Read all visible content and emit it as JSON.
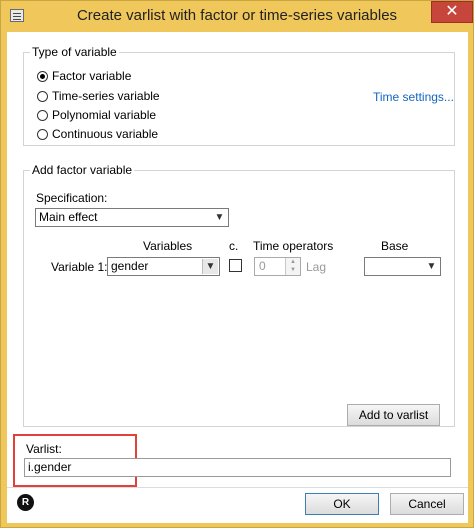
{
  "window": {
    "title": "Create varlist with factor or time-series variables",
    "close_glyph": "✕"
  },
  "type_group": {
    "legend": "Type of variable",
    "options": [
      {
        "label": "Factor variable",
        "checked": true
      },
      {
        "label": "Time-series variable",
        "checked": false
      },
      {
        "label": "Polynomial variable",
        "checked": false
      },
      {
        "label": "Continuous variable",
        "checked": false
      }
    ],
    "time_settings_link": "Time settings..."
  },
  "factor_group": {
    "legend": "Add factor variable",
    "specification_label": "Specification:",
    "specification_value": "Main effect",
    "col_variables": "Variables",
    "col_c": "c.",
    "col_time_operators": "Time operators",
    "col_base": "Base",
    "row_label": "Variable 1:",
    "variable_value": "gender",
    "time_op_value": "0",
    "lag_label": "Lag",
    "base_value": "",
    "add_button": "Add to varlist"
  },
  "varlist": {
    "label": "Varlist:",
    "value": "i.gender"
  },
  "footer": {
    "logo_text": "R",
    "ok": "OK",
    "cancel": "Cancel"
  },
  "colors": {
    "titlebar": "#f0c75a",
    "close": "#c7463b",
    "link": "#1565c0",
    "highlight": "#e0423a"
  }
}
